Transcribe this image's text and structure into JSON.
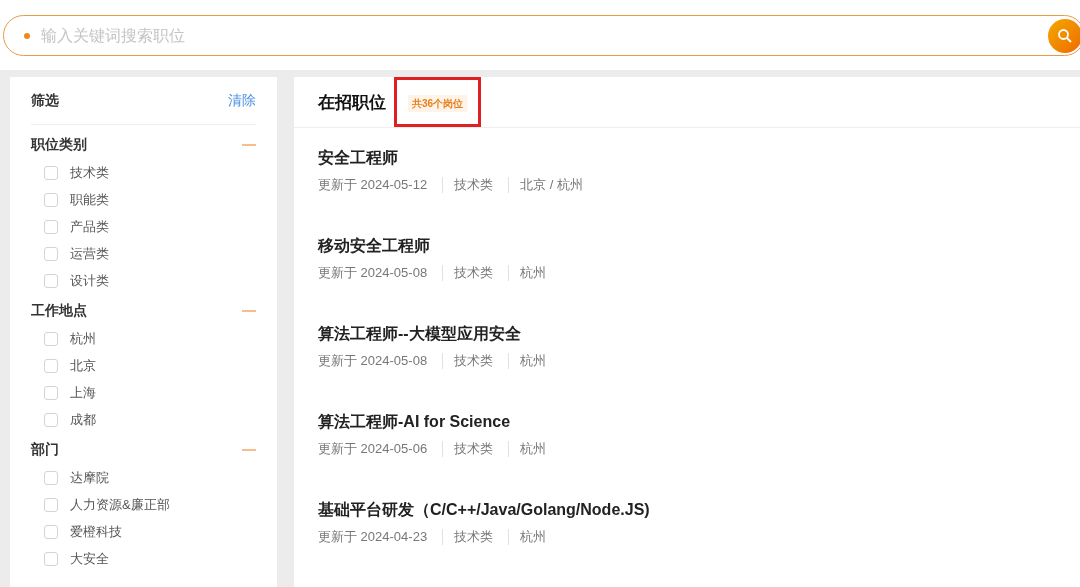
{
  "search": {
    "placeholder": "输入关键词搜索职位"
  },
  "filter": {
    "title": "筛选",
    "clear": "清除",
    "sections": [
      {
        "title": "职位类别",
        "expanded": true,
        "items": [
          {
            "label": "技术类",
            "checked": false
          },
          {
            "label": "职能类",
            "checked": false
          },
          {
            "label": "产品类",
            "checked": false
          },
          {
            "label": "运营类",
            "checked": false
          },
          {
            "label": "设计类",
            "checked": false
          }
        ]
      },
      {
        "title": "工作地点",
        "expanded": true,
        "items": [
          {
            "label": "杭州",
            "checked": false
          },
          {
            "label": "北京",
            "checked": false
          },
          {
            "label": "上海",
            "checked": false
          },
          {
            "label": "成都",
            "checked": false
          }
        ]
      },
      {
        "title": "部门",
        "expanded": true,
        "items": [
          {
            "label": "达摩院",
            "checked": false
          },
          {
            "label": "人力资源&廉正部",
            "checked": false
          },
          {
            "label": "爱橙科技",
            "checked": false
          },
          {
            "label": "大安全",
            "checked": false
          }
        ]
      }
    ]
  },
  "jobs": {
    "title": "在招职位",
    "count": "共36个岗位",
    "count_highlighted": true,
    "items": [
      {
        "title": "安全工程师",
        "updated": "更新于 2024-05-12",
        "category": "技术类",
        "location": "北京 / 杭州"
      },
      {
        "title": "移动安全工程师",
        "updated": "更新于 2024-05-08",
        "category": "技术类",
        "location": "杭州"
      },
      {
        "title": "算法工程师--大模型应用安全",
        "updated": "更新于 2024-05-08",
        "category": "技术类",
        "location": "杭州"
      },
      {
        "title": "算法工程师-AI for Science",
        "updated": "更新于 2024-05-06",
        "category": "技术类",
        "location": "杭州"
      },
      {
        "title": "基础平台研发（C/C++/Java/Golang/Node.JS)",
        "updated": "更新于 2024-04-23",
        "category": "技术类",
        "location": "杭州"
      }
    ]
  }
}
